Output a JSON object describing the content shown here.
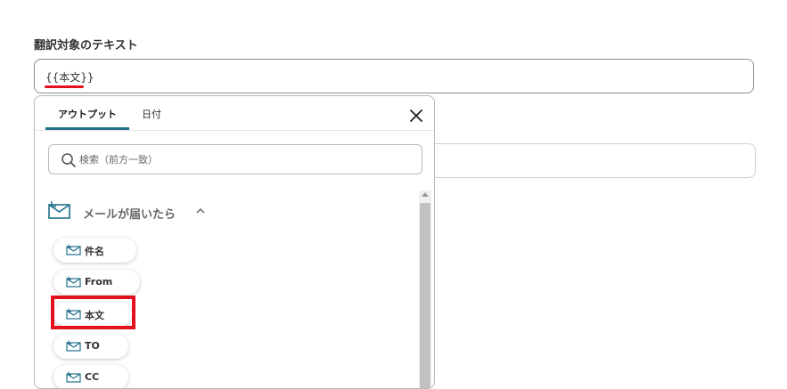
{
  "field": {
    "label": "翻訳対象のテキスト",
    "value": "{{本文}}"
  },
  "popover": {
    "tabs": [
      {
        "label": "アウトプット",
        "active": true
      },
      {
        "label": "日付",
        "active": false
      }
    ],
    "search_placeholder": "検索（前方一致）",
    "section_title": "メールが届いたら",
    "items": [
      {
        "label": "件名"
      },
      {
        "label": "From"
      },
      {
        "label": "本文"
      },
      {
        "label": "TO"
      },
      {
        "label": "CC"
      }
    ]
  },
  "colors": {
    "accent": "#1f6f8b",
    "highlight": "#e3111f"
  },
  "icons": {
    "close": "close-icon",
    "search": "search-icon",
    "section": "mail-icon",
    "collapse": "chevron-up-icon",
    "item": "mail-icon"
  }
}
